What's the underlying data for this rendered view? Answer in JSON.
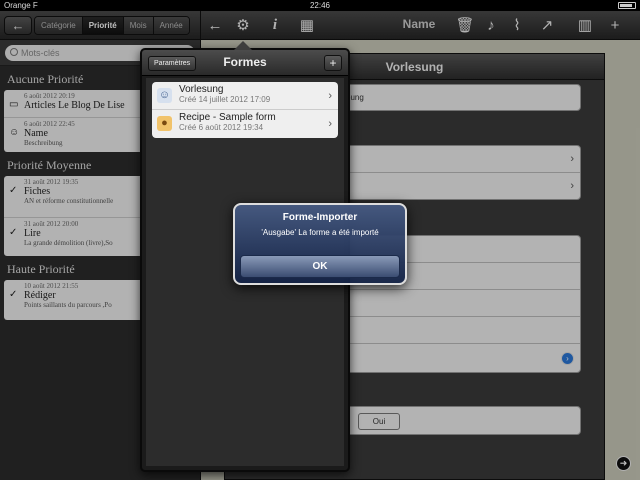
{
  "status": {
    "carrier": "Orange F",
    "time": "22:46"
  },
  "left": {
    "back_label": "←",
    "segments": [
      "Catégorie",
      "Priorité",
      "Mois",
      "Année"
    ],
    "search_placeholder": "Mots-clés",
    "sections": [
      {
        "title": "Aucune Priorité",
        "items": [
          {
            "date": "6 août 2012 20:19",
            "title": "Articles Le Blog De Lise",
            "sub": ""
          },
          {
            "date": "6 août 2012 22:45",
            "title": "Name",
            "sub": "Beschreibung"
          }
        ]
      },
      {
        "title": "Priorité Moyenne",
        "items": [
          {
            "date": "31 août 2012 19:35",
            "title": "Fiches",
            "sub": "AN et réforme constitutionnelle"
          },
          {
            "date": "31 août 2012 20:00",
            "title": "Lire",
            "sub": "La grande démolition (livre),So"
          }
        ]
      },
      {
        "title": "Haute Priorité",
        "items": [
          {
            "date": "10 août 2012 21:55",
            "title": "Rédiger",
            "sub": "Points saillants du parcours ,Po"
          }
        ]
      }
    ]
  },
  "right": {
    "toolbar_title": "Name",
    "form_title": "Vorlesung",
    "partial_field": "bung",
    "toggle_label": "Oui"
  },
  "popover": {
    "title": "Formes",
    "params_label": "Paramètres",
    "plus_label": "+",
    "items": [
      {
        "title": "Vorlesung",
        "date": "Créé 14 juillet 2012 17:09"
      },
      {
        "title": "Recipe - Sample form",
        "date": "Créé 6 août 2012 19:34"
      }
    ]
  },
  "alert": {
    "title": "Forme-Importer",
    "message": "'Ausgabe' La forme a été importé",
    "ok_label": "OK"
  }
}
